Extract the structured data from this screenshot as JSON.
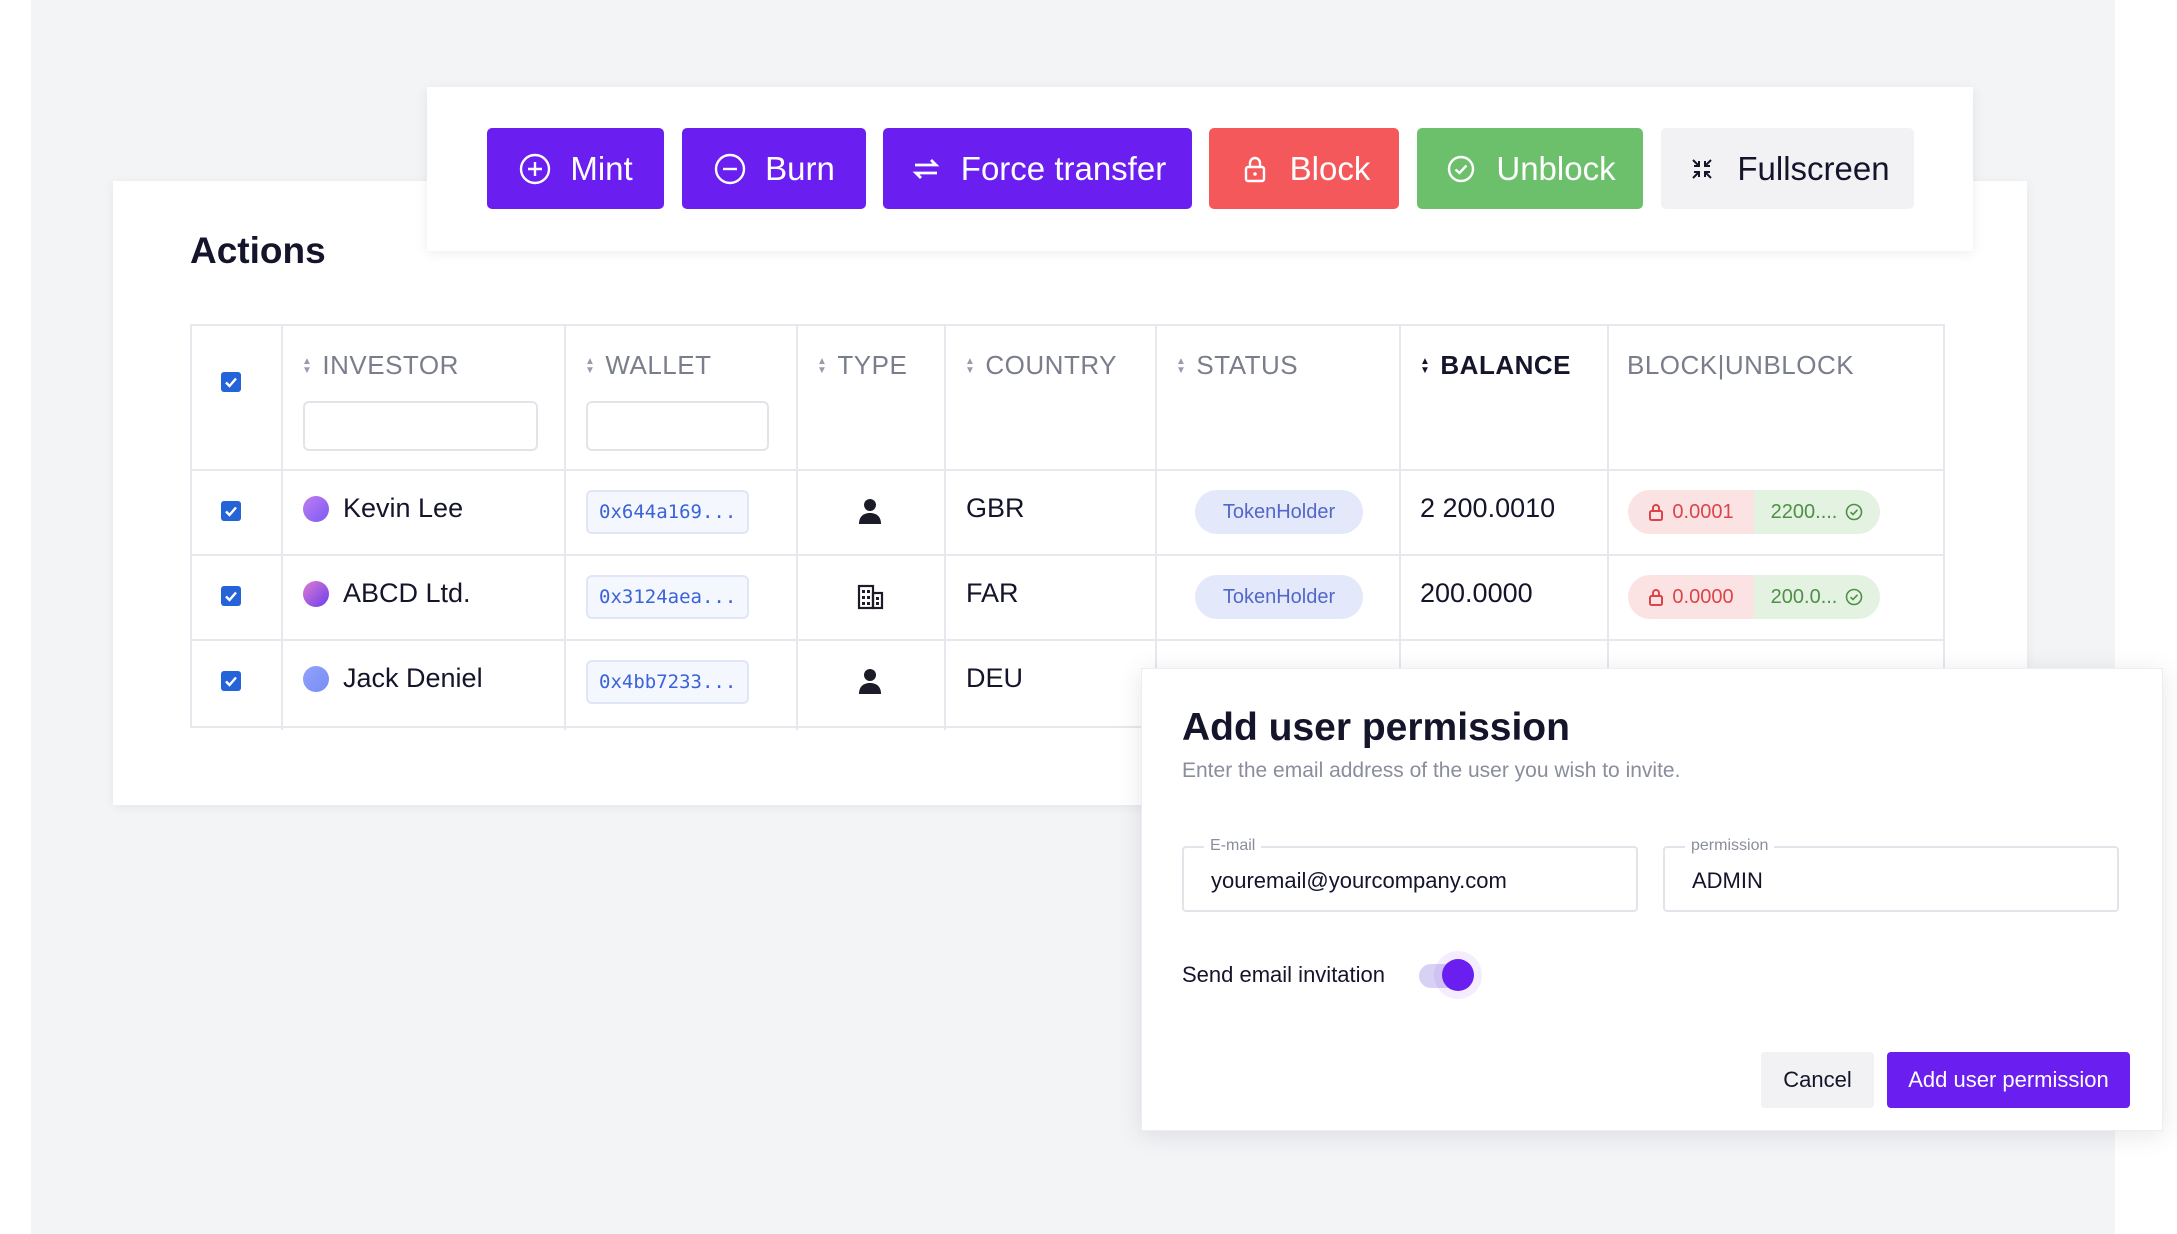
{
  "toolbar": {
    "buttons": [
      {
        "label": "Mint",
        "icon": "plus-circle-icon"
      },
      {
        "label": "Burn",
        "icon": "minus-circle-icon"
      },
      {
        "label": "Force transfer",
        "icon": "swap-arrows-icon"
      },
      {
        "label": "Block",
        "icon": "lock-icon"
      },
      {
        "label": "Unblock",
        "icon": "check-circle-icon"
      },
      {
        "label": "Fullscreen",
        "icon": "collapse-arrows-icon"
      }
    ]
  },
  "actions": {
    "title": "Actions",
    "table": {
      "columns": [
        "INVESTOR",
        "WALLET",
        "TYPE",
        "COUNTRY",
        "STATUS",
        "BALANCE",
        "BLOCK|UNBLOCK"
      ],
      "sorted_column": "BALANCE",
      "rows": [
        {
          "checked": true,
          "investor": "Kevin Lee",
          "wallet": "0x644a169...",
          "type": "person-icon",
          "country": "GBR",
          "status": "TokenHolder",
          "balance": "2 200.0010",
          "blocked": "0.0001",
          "unblocked": "2200...."
        },
        {
          "checked": true,
          "investor": "ABCD Ltd.",
          "wallet": "0x3124aea...",
          "type": "building-icon",
          "country": "FAR",
          "status": "TokenHolder",
          "balance": "200.0000",
          "blocked": "0.0000",
          "unblocked": "200.0..."
        },
        {
          "checked": true,
          "investor": "Jack Deniel",
          "wallet": "0x4bb7233...",
          "type": "person-icon",
          "country": "DEU",
          "status": "",
          "balance": "",
          "blocked": "",
          "unblocked": ""
        }
      ]
    }
  },
  "modal": {
    "title": "Add user permission",
    "subtitle": "Enter the email address of the user you wish to invite.",
    "email_label": "E-mail",
    "email_value": "youremail@yourcompany.com",
    "permission_label": "permission",
    "permission_value": "ADMIN",
    "toggle_label": "Send email invitation",
    "toggle_on": true,
    "cancel_label": "Cancel",
    "submit_label": "Add user permission"
  },
  "colors": {
    "primary": "#6a1ef0",
    "danger": "#f5585a",
    "success": "#6cc06b",
    "link": "#3b63d8"
  }
}
